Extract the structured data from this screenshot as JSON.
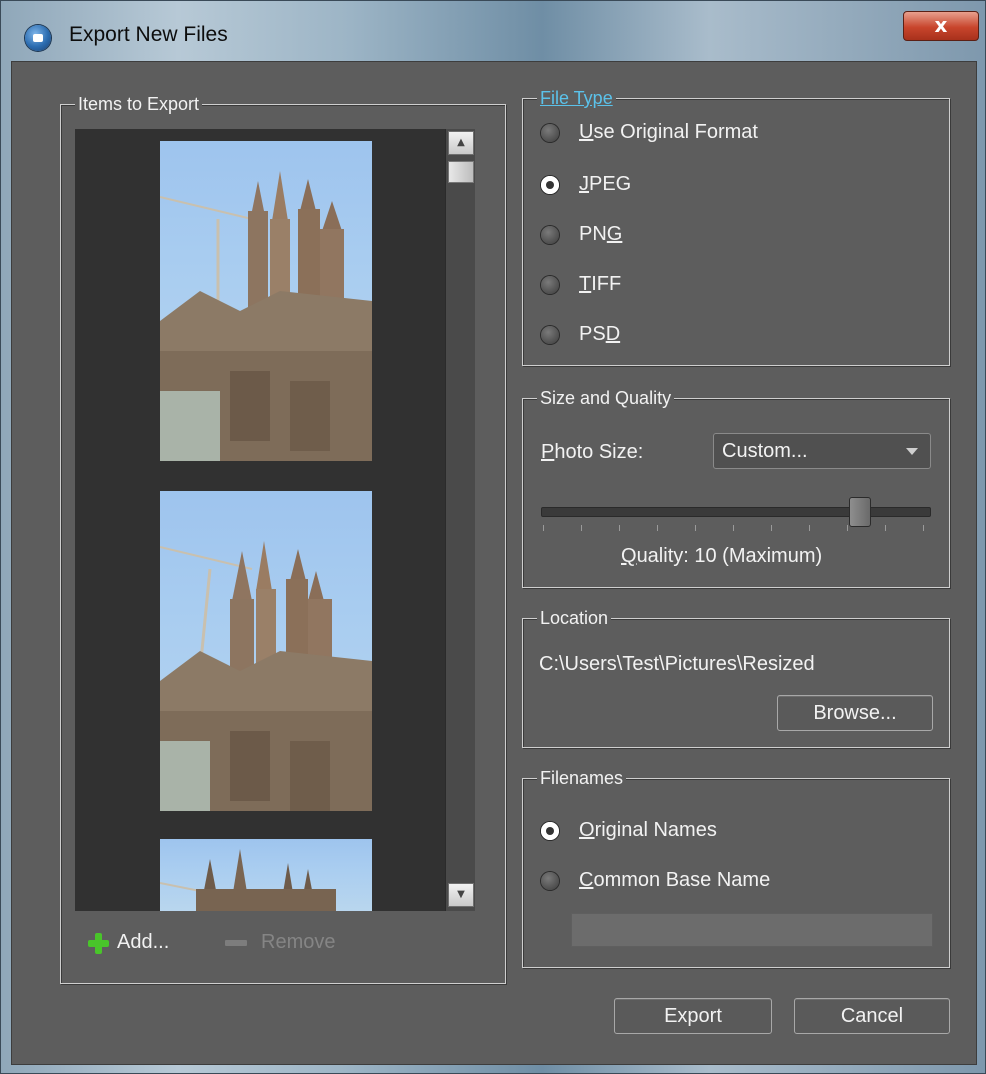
{
  "window": {
    "title": "Export New Files",
    "close_label": "x"
  },
  "items_group": {
    "legend": "Items to Export",
    "add_label": "Add...",
    "remove_label": "Remove"
  },
  "file_type": {
    "legend": "File Type",
    "options": [
      {
        "pre": "",
        "key": "U",
        "post": "se Original Format",
        "selected": false
      },
      {
        "pre": "",
        "key": "J",
        "post": "PEG",
        "selected": true
      },
      {
        "pre": "PN",
        "key": "G",
        "post": "",
        "selected": false
      },
      {
        "pre": "",
        "key": "T",
        "post": "IFF",
        "selected": false
      },
      {
        "pre": "PS",
        "key": "D",
        "post": "",
        "selected": false
      }
    ]
  },
  "size_quality": {
    "legend": "Size and Quality",
    "photo_size_key": "P",
    "photo_size_rest": "hoto Size:",
    "photo_size_value": "Custom...",
    "quality_key": "Q",
    "quality_rest": "uality: 10 (Maximum)",
    "quality_level": 10,
    "quality_max": 10
  },
  "location": {
    "legend": "Location",
    "path": "C:\\Users\\Test\\Pictures\\Resized",
    "browse_label": "Browse..."
  },
  "filenames": {
    "legend": "Filenames",
    "options": [
      {
        "key": "O",
        "post": "riginal Names",
        "selected": true
      },
      {
        "key": "C",
        "post": "ommon Base Name",
        "selected": false
      }
    ],
    "base_name_value": ""
  },
  "footer": {
    "export_label": "Export",
    "cancel_label": "Cancel"
  },
  "icons": [
    "app-camera-icon",
    "close-icon",
    "add-plus-icon",
    "remove-minus-icon",
    "scroll-up-icon",
    "scroll-down-icon",
    "dropdown-arrow-icon"
  ]
}
